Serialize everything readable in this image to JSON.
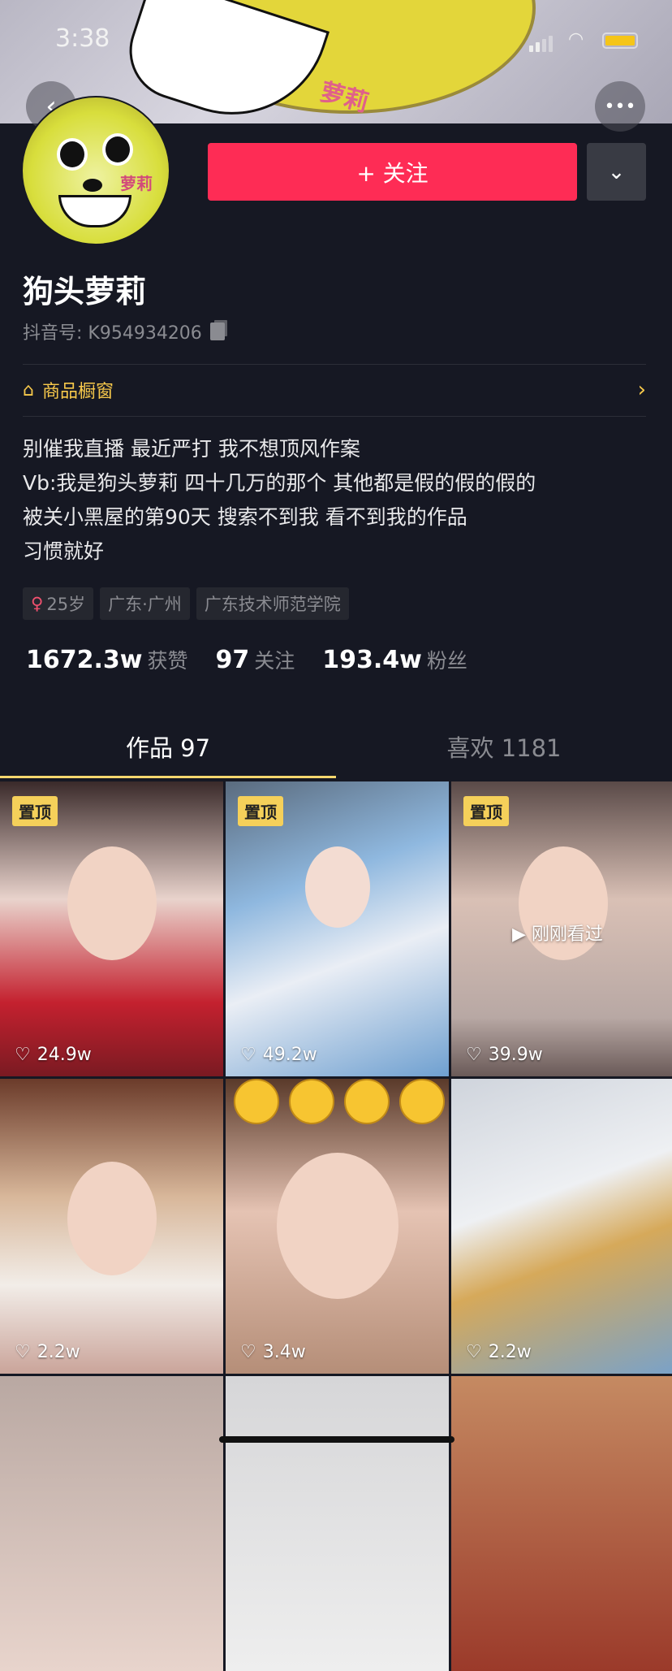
{
  "status_bar": {
    "time": "3:38"
  },
  "header": {
    "banner_text": "萝莉",
    "avatar_text": "萝莉"
  },
  "actions": {
    "follow_label": "+ 关注",
    "dropdown_icon": "chevron-down-icon",
    "back_icon": "chevron-left-icon",
    "more_icon": "more-icon"
  },
  "profile": {
    "name": "狗头萝莉",
    "douyin_id": "抖音号: K954934206",
    "shop_label": "商品橱窗",
    "bio": [
      "别催我直播 最近严打 我不想顶风作案",
      "Vb:我是狗头萝莉 四十几万的那个 其他都是假的假的假的",
      "被关小黑屋的第90天 搜索不到我 看不到我的作品",
      "习惯就好"
    ],
    "tags": [
      {
        "label": "25岁",
        "icon": "female-icon"
      },
      {
        "label": "广东·广州"
      },
      {
        "label": "广东技术师范学院"
      }
    ],
    "stats": [
      {
        "value": "1672.3w",
        "label": "获赞"
      },
      {
        "value": "97",
        "label": "关注"
      },
      {
        "value": "193.4w",
        "label": "粉丝"
      }
    ]
  },
  "tabs": [
    {
      "label": "作品 97",
      "active": true
    },
    {
      "label": "喜欢 1181",
      "active": false
    }
  ],
  "videos": [
    {
      "pinned": "置顶",
      "likes": "24.9w"
    },
    {
      "pinned": "置顶",
      "likes": "49.2w"
    },
    {
      "pinned": "置顶",
      "likes": "39.9w",
      "overlay": "刚刚看过"
    },
    {
      "likes": "2.2w"
    },
    {
      "likes": "3.4w"
    },
    {
      "likes": "2.2w"
    },
    {},
    {},
    {}
  ],
  "colors": {
    "accent": "#fe2c55",
    "background": "#161823",
    "shop": "#f8c94b",
    "tab_indicator": "#f5d76e"
  }
}
